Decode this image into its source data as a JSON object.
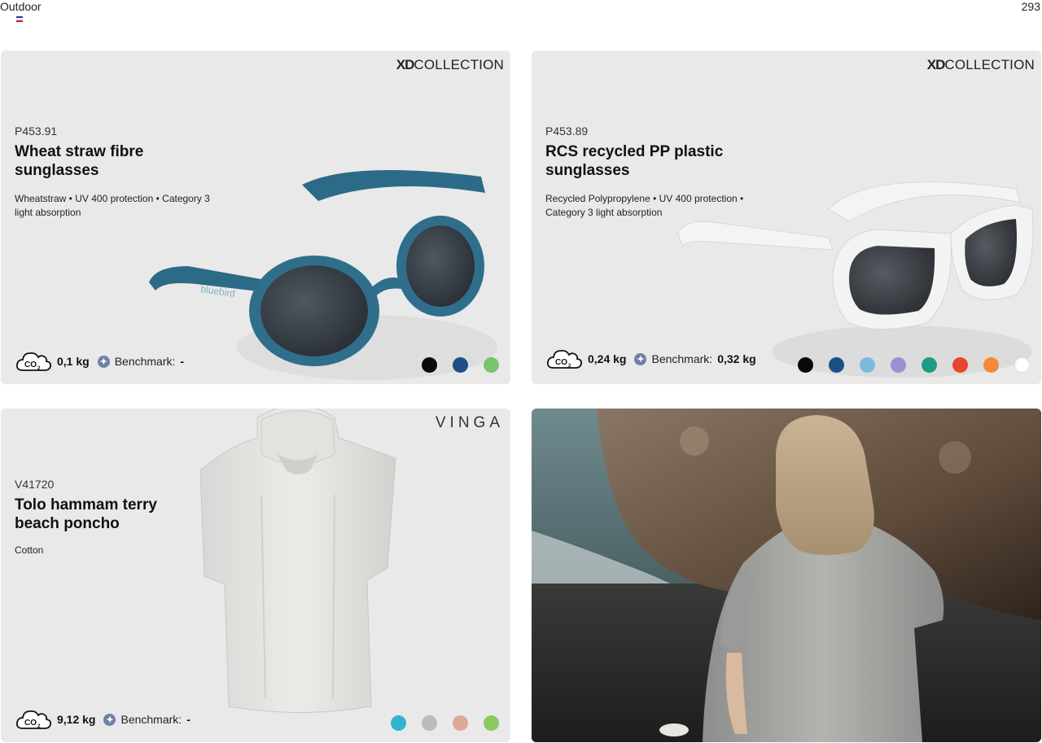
{
  "header": {
    "section": "Outdoor",
    "page_number": "293"
  },
  "products": [
    {
      "brand_bold": "XD",
      "brand_light": "COLLECTION",
      "sku": "P453.91",
      "title": "Wheat straw fibre sunglasses",
      "description": "Wheatstraw • UV 400 protection • Category 3 light absorption",
      "co2_weight": "0,1 kg",
      "benchmark_label": "Benchmark:",
      "benchmark_value": "-",
      "frame_logo": "bluebird",
      "colors": [
        "#0a0a0a",
        "#1b4f86",
        "#7bc46a"
      ]
    },
    {
      "brand_bold": "XD",
      "brand_light": "COLLECTION",
      "sku": "P453.89",
      "title": "RCS recycled PP plastic sunglasses",
      "description": "Recycled Polypropylene • UV 400 protection • Category 3 light absorption",
      "co2_weight": "0,24 kg",
      "benchmark_label": "Benchmark:",
      "benchmark_value": "0,32 kg",
      "colors": [
        "#0a0a0a",
        "#1b4f86",
        "#7db8e0",
        "#9b8fcf",
        "#1f9b85",
        "#e8452c",
        "#f28a3a",
        "#ffffff"
      ]
    },
    {
      "brand": "VINGA",
      "sku": "V41720",
      "title": "Tolo hammam terry beach poncho",
      "description": "Cotton",
      "co2_weight": "9,12 kg",
      "benchmark_label": "Benchmark:",
      "benchmark_value": "-",
      "colors": [
        "#2fb3d2",
        "#b9bcbf",
        "#e0a896",
        "#8dc85f"
      ]
    }
  ],
  "co2_icon_text": "CO",
  "co2_icon_sub": "2",
  "icons": {
    "co2": "co2-cloud-icon",
    "benchmark": "benchmark-star-icon"
  },
  "photo": {
    "subject": "woman-in-poncho-by-sea"
  }
}
